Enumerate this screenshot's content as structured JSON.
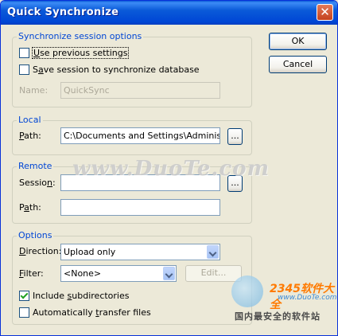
{
  "window": {
    "title": "Quick Synchronize",
    "close_glyph": "✕"
  },
  "buttons": {
    "ok": "OK",
    "cancel": "Cancel"
  },
  "session_options": {
    "title": "Synchronize session options",
    "use_previous": {
      "label_pre": "",
      "label_ul": "U",
      "label_post": "se previous settings",
      "checked": false
    },
    "save_session": {
      "label_pre": "S",
      "label_ul": "a",
      "label_post": "ve session to synchronize database",
      "checked": false
    },
    "name_label": "Name:",
    "name_value": "QuickSync"
  },
  "local": {
    "title": "Local",
    "path_label_ul": "P",
    "path_label_post": "ath:",
    "path_value": "C:\\Documents and Settings\\Administrato",
    "browse": "..."
  },
  "remote": {
    "title": "Remote",
    "session_label_pre": "Sessio",
    "session_label_ul": "n",
    "session_label_post": ":",
    "session_value": "",
    "browse": "...",
    "path_label_pre": "P",
    "path_label_ul": "a",
    "path_label_post": "th:",
    "path_value": ""
  },
  "options": {
    "title": "Options",
    "direction_label_pre": "",
    "direction_label_ul": "D",
    "direction_label_post": "irection:",
    "direction_value": "Upload only",
    "filter_label_ul": "F",
    "filter_label_post": "ilter:",
    "filter_value": "<None>",
    "edit_button": "Edit...",
    "include_subdirs": {
      "label_pre": "Include ",
      "label_ul": "s",
      "label_post": "ubdirectories",
      "checked": true
    },
    "auto_transfer": {
      "label_pre": "Automatically ",
      "label_ul": "t",
      "label_post": "ransfer files",
      "checked": false
    }
  },
  "watermarks": {
    "site": "www.DuoTe.com",
    "brand_2345": "2345软件大全",
    "brand_url": "www.DuoTe.com",
    "brand_tagline": "国内最安全的软件站"
  }
}
